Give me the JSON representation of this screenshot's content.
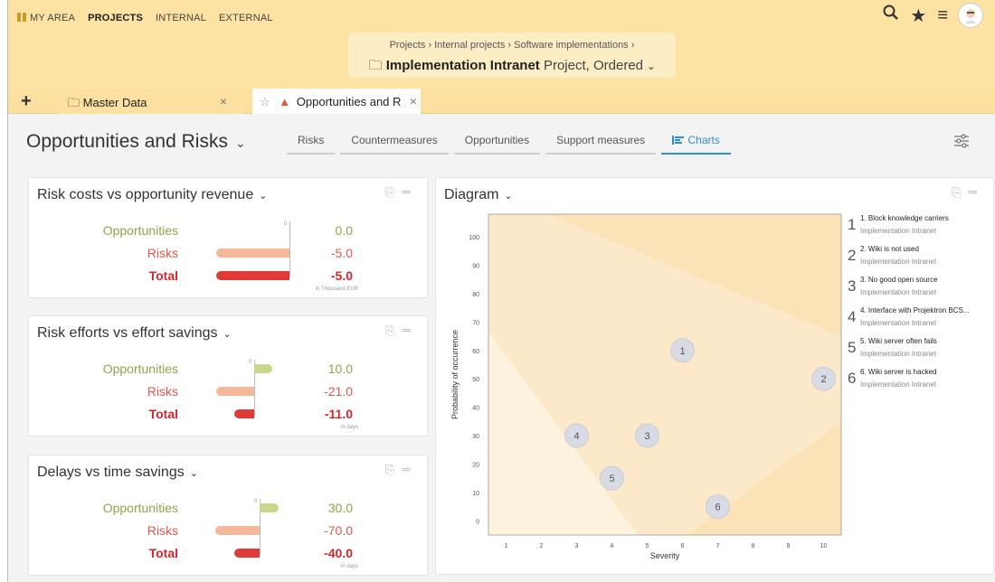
{
  "topnav": {
    "items": [
      "MY AREA",
      "PROJECTS",
      "INTERNAL",
      "EXTERNAL"
    ],
    "active": "PROJECTS"
  },
  "breadcrumb": {
    "path": "Projects  ›  Internal projects  ›  Software implementations  ›",
    "project_name": "Implementation Intranet",
    "project_type": "Project, Ordered"
  },
  "tabs": [
    {
      "label": "Master Data"
    },
    {
      "label": "Opportunities and R"
    }
  ],
  "page": {
    "title": "Opportunities and Risks",
    "subtabs": [
      "Risks",
      "Countermeasures",
      "Opportunities",
      "Support measures",
      "Charts"
    ],
    "active_subtab": "Charts"
  },
  "cards": [
    {
      "title": "Risk costs vs opportunity revenue",
      "rows": [
        {
          "label": "Opportunities",
          "value": "0.0"
        },
        {
          "label": "Risks",
          "value": "-5.0"
        },
        {
          "label": "Total",
          "value": "-5.0"
        }
      ],
      "unit": "in Thousand EUR",
      "zero_label": "0"
    },
    {
      "title": "Risk efforts vs effort savings",
      "rows": [
        {
          "label": "Opportunities",
          "value": "10.0"
        },
        {
          "label": "Risks",
          "value": "-21.0"
        },
        {
          "label": "Total",
          "value": "-11.0"
        }
      ],
      "unit": "in days",
      "zero_label": "0"
    },
    {
      "title": "Delays vs time savings",
      "rows": [
        {
          "label": "Opportunities",
          "value": "30.0"
        },
        {
          "label": "Risks",
          "value": "-70.0"
        },
        {
          "label": "Total",
          "value": "-40.0"
        }
      ],
      "unit": "in days",
      "zero_label": "0"
    }
  ],
  "diagram": {
    "title": "Diagram",
    "legend": [
      {
        "num": "1",
        "title": "1. Block knowledge carriers",
        "sub": "Implementation Intranet"
      },
      {
        "num": "2",
        "title": "2. Wiki is not used",
        "sub": "Implementation Intranet"
      },
      {
        "num": "3",
        "title": "3. No good open source",
        "sub": "Implementation Intranet"
      },
      {
        "num": "4",
        "title": "4. Interface with Projektron BCS...",
        "sub": "Implementation Intranet"
      },
      {
        "num": "5",
        "title": "5. Wiki server often fails",
        "sub": "Implementation Intranet"
      },
      {
        "num": "6",
        "title": "6. Wiki server is hacked",
        "sub": "Implementation Intranet"
      }
    ]
  },
  "chart_data": [
    {
      "type": "bar",
      "categories": [
        "Opportunities",
        "Risks",
        "Total"
      ],
      "values": [
        0.0,
        -5.0,
        -5.0
      ],
      "title": "Risk costs vs opportunity revenue"
    },
    {
      "type": "bar",
      "categories": [
        "Opportunities",
        "Risks",
        "Total"
      ],
      "values": [
        10.0,
        -21.0,
        -11.0
      ],
      "title": "Risk efforts vs effort savings"
    },
    {
      "type": "bar",
      "categories": [
        "Opportunities",
        "Risks",
        "Total"
      ],
      "values": [
        30.0,
        -70.0,
        -40.0
      ],
      "title": "Delays vs time savings"
    },
    {
      "type": "scatter",
      "xlabel": "Severity",
      "ylabel": "Probability of occurrence",
      "xlim": [
        0.5,
        10.5
      ],
      "ylim": [
        -5,
        108
      ],
      "x_ticks": [
        1,
        2,
        3,
        4,
        5,
        6,
        7,
        8,
        9,
        10
      ],
      "y_ticks": [
        0,
        10,
        20,
        30,
        40,
        50,
        60,
        70,
        80,
        90,
        100
      ],
      "points": [
        {
          "label": "1",
          "x": 6,
          "y": 60
        },
        {
          "label": "2",
          "x": 10,
          "y": 50
        },
        {
          "label": "3",
          "x": 5,
          "y": 30
        },
        {
          "label": "4",
          "x": 3,
          "y": 30
        },
        {
          "label": "5",
          "x": 4,
          "y": 15
        },
        {
          "label": "6",
          "x": 7,
          "y": 5
        }
      ]
    }
  ]
}
